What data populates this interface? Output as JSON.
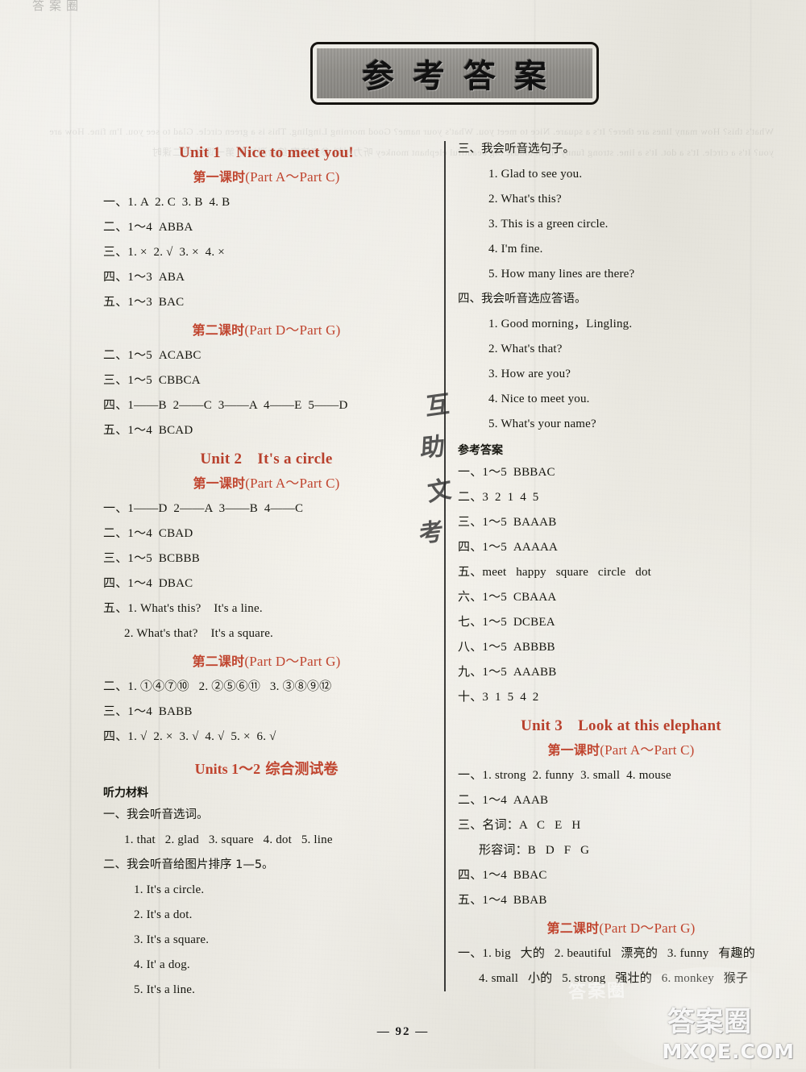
{
  "banner": {
    "chars": [
      "参",
      "考",
      "答",
      "案"
    ]
  },
  "page_number": "— 92 —",
  "watermarks": {
    "seal": "答案圈",
    "domain": "MXQE.COM",
    "mid_ghost": "答案圈",
    "top_faint": "答案圈"
  },
  "handwriting": [
    "互",
    "助",
    "文",
    "考"
  ],
  "left_column": {
    "unit1": {
      "unit_label": "Unit 1",
      "unit_title": "Nice to meet you!",
      "lesson1": {
        "cn": "第一课时",
        "paren": "(Part A～Part C)",
        "answers": [
          "一、1. A  2. C  3. B  4. B",
          "二、1～4  ABBA",
          "三、1. ×  2. √  3. ×  4. ×",
          "四、1～3  ABA",
          "五、1～3  BAC"
        ]
      },
      "lesson2": {
        "cn": "第二课时",
        "paren": "(Part D～Part G)",
        "answers": [
          "二、1～5  ACABC",
          "三、1～5  CBBCA",
          "四、1——B  2——C  3——A  4——E  5——D",
          "五、1～4  BCAD"
        ]
      }
    },
    "unit2": {
      "unit_label": "Unit 2",
      "unit_title": "It's a circle",
      "lesson1": {
        "cn": "第一课时",
        "paren": "(Part A～Part C)",
        "answers": [
          "一、1——D  2——A  3——B  4——C",
          "二、1～4  CBAD",
          "三、1～5  BCBBB",
          "四、1～4  DBAC",
          "五、1. What's this?    It's a line."
        ],
        "answers_indent": [
          "2. What's that?    It's a square."
        ]
      },
      "lesson2": {
        "cn": "第二课时",
        "paren": "(Part D～Part G)",
        "answers": [
          "二、1. ①④⑦⑩   2. ②⑤⑥⑪   3. ③⑧⑨⑫",
          "三、1～4  BABB",
          "四、1. √  2. ×  3. √  4. √  5. ×  6. √"
        ]
      }
    },
    "test": {
      "title_lat": "Units 1～2",
      "title_cn": "综合测试卷",
      "sub_head": "听力材料",
      "q1_head": "一、我会听音选词。",
      "q1_items": "1. that   2. glad   3. square   4. dot   5. line",
      "q2_head": "二、我会听音给图片排序 1—5。",
      "q2_items": [
        "1. It's a circle.",
        "2. It's a dot.",
        "3. It's a square.",
        "4. It' a dog.",
        "5. It's a line."
      ]
    }
  },
  "right_column": {
    "q3_head": "三、我会听音选句子。",
    "q3_items": [
      "1. Glad to see you.",
      "2. What's this?",
      "3. This is a green circle.",
      "4. I'm fine.",
      "5. How many lines are there?"
    ],
    "q4_head": "四、我会听音选应答语。",
    "q4_items": [
      "1. Good morning，Lingling.",
      "2. What's that?",
      "3. How are you?",
      "4. Nice to meet you.",
      "5. What's your name?"
    ],
    "answers_head": "参考答案",
    "answers": [
      "一、1～5  BBBAC",
      "二、3  2  1  4  5",
      "三、1～5  BAAAB",
      "四、1～5  AAAAA",
      "五、meet   happy   square   circle   dot",
      "六、1～5  CBAAA",
      "七、1～5  DCBEA",
      "八、1～5  ABBBB",
      "九、1～5  AAABB",
      "十、3  1  5  4  2"
    ],
    "unit3": {
      "unit_label": "Unit 3",
      "unit_title": "Look at this elephant",
      "lesson1": {
        "cn": "第一课时",
        "paren": "(Part A～Part C)",
        "answers": [
          "一、1. strong  2. funny  3. small  4. mouse",
          "二、1～4  AAAB",
          "三、名词：A   C   E   H"
        ],
        "answers_indent": [
          "形容词：B   D   F   G"
        ],
        "answers_after": [
          "四、1～4  BBAC",
          "五、1～4  BBAB"
        ]
      },
      "lesson2": {
        "cn": "第二课时",
        "paren": "(Part D～Part G)",
        "answers": [
          "一、1. big   大的   2. beautiful   漂亮的   3. funny   有趣的"
        ],
        "answers_indent": [
          "4. small   小的   5. strong   强壮的   6. monkey   猴子"
        ]
      }
    }
  },
  "showthrough_text": "What's this? How many lines are there? It's a square. Nice to meet you. What's your name? Good morning Lingling. This is a green circle. Glad to see you. I'm fine. How are you? It's a circle. It's a dot. It's a line. strong funny small mouse big beautiful elephant monkey 听力材料 参考答案 综合测试卷 第一课时 第二课时"
}
